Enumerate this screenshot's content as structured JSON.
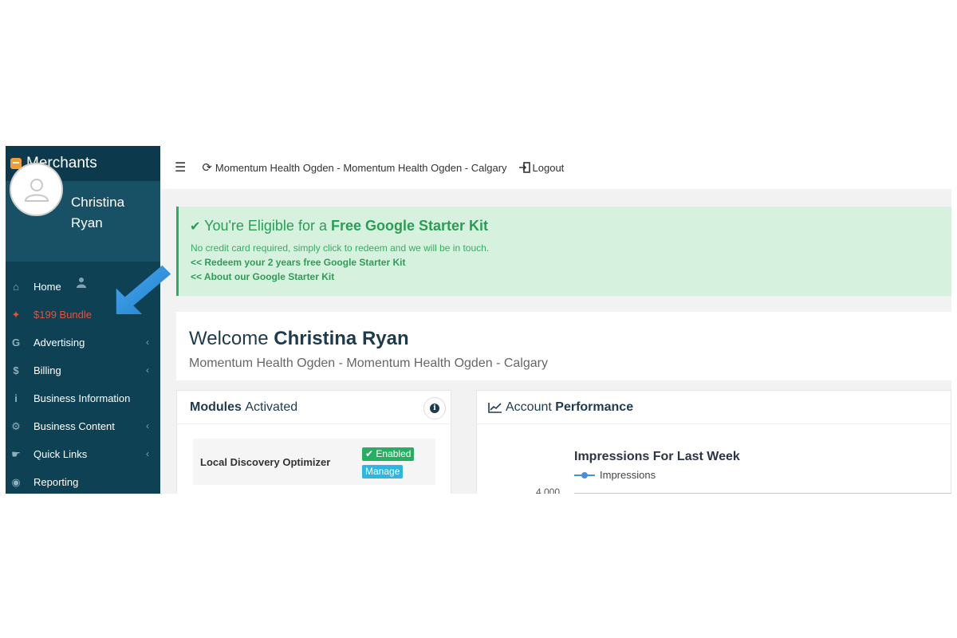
{
  "brand": {
    "name": "Merchants"
  },
  "user": {
    "first_name": "Christina",
    "last_name": "Ryan"
  },
  "sidebar": {
    "items": [
      {
        "label": "Home",
        "icon": "home-icon",
        "glyph": "⌂"
      },
      {
        "label": "$199 Bundle",
        "icon": "flame-icon",
        "glyph": "🔥"
      },
      {
        "label": "Advertising",
        "icon": "google-icon",
        "glyph": "G"
      },
      {
        "label": "Billing",
        "icon": "dollar-icon",
        "glyph": "$"
      },
      {
        "label": "Business Information",
        "icon": "info-icon",
        "glyph": "i"
      },
      {
        "label": "Business Content",
        "icon": "gear-icon",
        "glyph": "⚙"
      },
      {
        "label": "Quick Links",
        "icon": "hand-icon",
        "glyph": "☛"
      },
      {
        "label": "Reporting",
        "icon": "dashboard-icon",
        "glyph": "◉"
      }
    ]
  },
  "header": {
    "location": "Momentum Health Ogden - Momentum Health Ogden - Calgary",
    "logout_label": "Logout"
  },
  "promo": {
    "title_prefix": "You're Eligible for a",
    "title_bold": "Free Google Starter Kit",
    "subtitle": "No credit card required, simply click to redeem and we will be in touch.",
    "link_redeem": "<< Redeem your 2 years free Google Starter Kit",
    "link_about": "<< About our Google Starter Kit",
    "accent_color": "#27ae60"
  },
  "welcome": {
    "prefix": "Welcome",
    "name": "Christina Ryan",
    "subtitle": "Momentum Health Ogden - Momentum Health Ogden - Calgary"
  },
  "modules": {
    "title_bold": "Modules",
    "title_rest": "Activated",
    "items": [
      {
        "name": "Local Discovery Optimizer",
        "status": "Enabled",
        "action": "Manage"
      }
    ]
  },
  "performance": {
    "title_rest": "Account",
    "title_bold": "Performance"
  },
  "chart_data": {
    "type": "line",
    "title": "Impressions For Last Week",
    "series": [
      {
        "name": "Impressions",
        "values": []
      }
    ],
    "y_tick_top": "4,000"
  }
}
